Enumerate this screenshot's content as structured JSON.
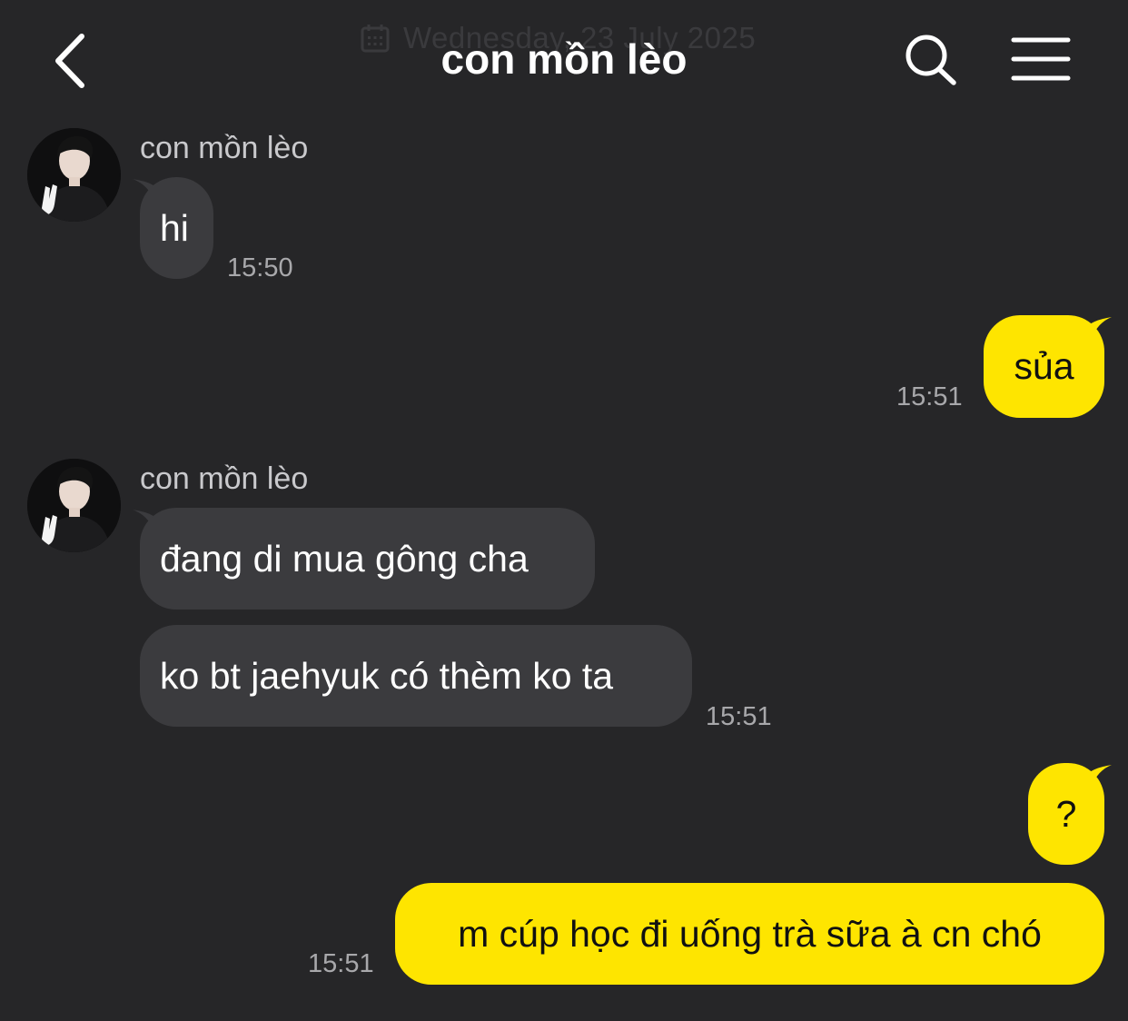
{
  "header": {
    "date_overlay": "Wednesday, 23 July 2025",
    "title": "con mồn lèo",
    "icons": {
      "back": "chevron-left-icon",
      "search": "search-icon",
      "menu": "hamburger-menu-icon"
    }
  },
  "colors": {
    "background": "#262628",
    "incoming_bubble": "#3b3b3e",
    "outgoing_bubble": "#fee500",
    "timestamp": "#a8a8ab"
  },
  "messages": [
    {
      "direction": "incoming",
      "sender": "con mồn lèo",
      "texts": [
        "hi"
      ],
      "time": "15:50"
    },
    {
      "direction": "outgoing",
      "texts": [
        "sủa"
      ],
      "time": "15:51"
    },
    {
      "direction": "incoming",
      "sender": "con mồn lèo",
      "texts": [
        "đang di mua gông cha",
        "ko bt jaehyuk có thèm ko ta"
      ],
      "time": "15:51"
    },
    {
      "direction": "outgoing",
      "texts": [
        "?",
        "m cúp học đi uống trà sữa à cn chó"
      ],
      "time": "15:51"
    }
  ]
}
